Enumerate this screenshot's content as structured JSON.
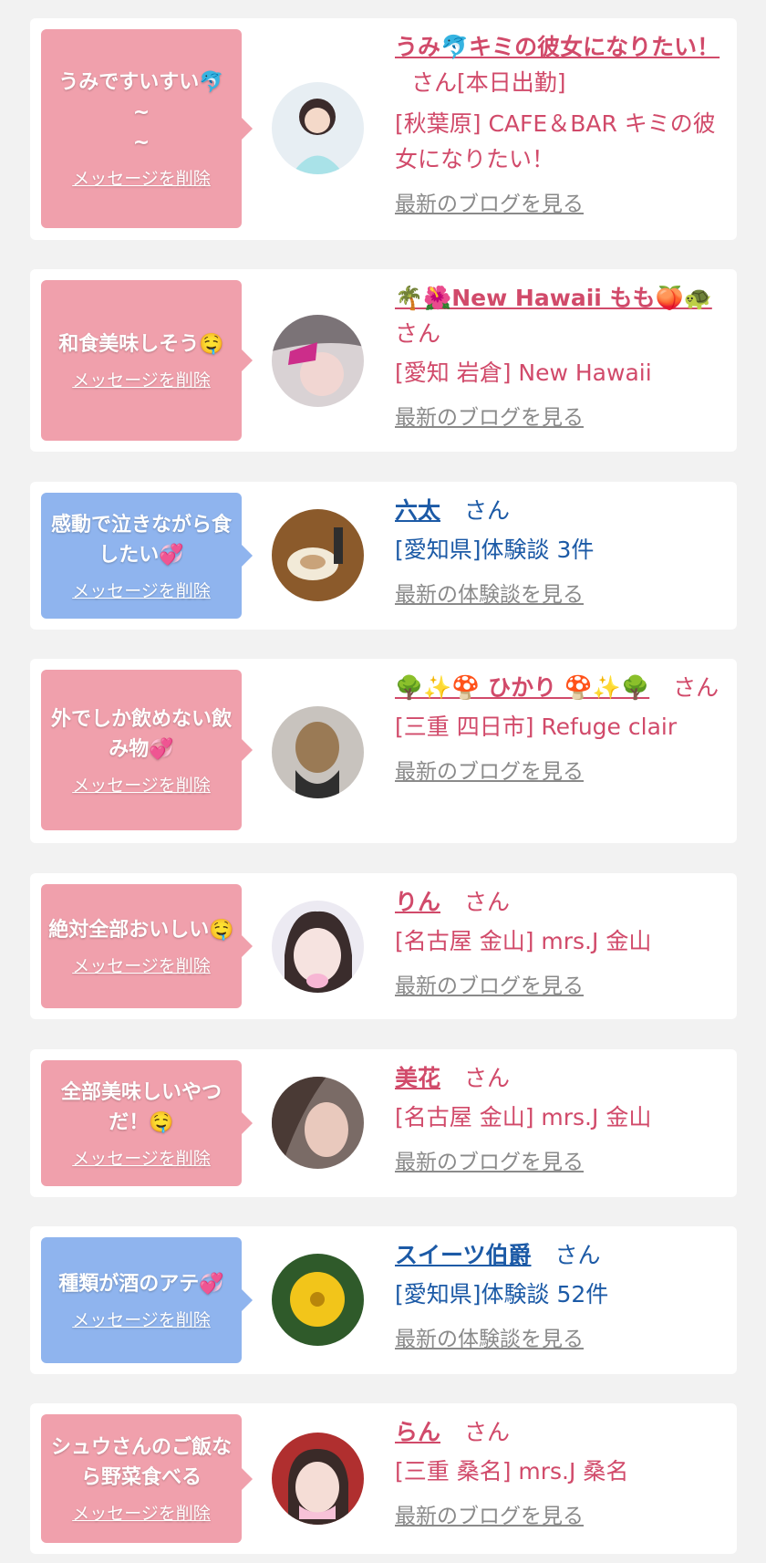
{
  "items": [
    {
      "bubble_color": "#f0a0ac",
      "message": "うみですいすい🐬\n~\n~",
      "delete_label": "メッセージを削除",
      "name": "うみ🐬キミの彼女になりたい！",
      "san": "さん[本日出勤]",
      "shop": "[秋葉原] CAFE＆BAR キミの彼女になりたい！",
      "more": "最新のブログを見る",
      "theme": "pink"
    },
    {
      "bubble_color": "#f0a0ac",
      "message": "和食美味しそう🤤",
      "delete_label": "メッセージを削除",
      "name": "🌴🌺New Hawaii もも🍑🐢",
      "san": "さん",
      "shop": "[愛知 岩倉] New Hawaii",
      "more": "最新のブログを見る",
      "theme": "pink"
    },
    {
      "bubble_color": "#8fb4ee",
      "message": "感動で泣きながら食したい💞",
      "delete_label": "メッセージを削除",
      "name": "六太",
      "san": "さん",
      "shop": "[愛知県]体験談 3件",
      "more": "最新の体験談を見る",
      "theme": "blue"
    },
    {
      "bubble_color": "#f0a0ac",
      "message": "外でしか飲めない飲み物💞",
      "delete_label": "メッセージを削除",
      "name": "🌳✨🍄 ひかり 🍄✨🌳",
      "san": "さん",
      "shop": "[三重 四日市] Refuge clair",
      "more": "最新のブログを見る",
      "theme": "pink"
    },
    {
      "bubble_color": "#f0a0ac",
      "message": "絶対全部おいしい🤤",
      "delete_label": "メッセージを削除",
      "name": "りん",
      "san": "さん",
      "shop": "[名古屋 金山] mrs.J 金山",
      "more": "最新のブログを見る",
      "theme": "pink"
    },
    {
      "bubble_color": "#f0a0ac",
      "message": "全部美味しいやつだ！🤤",
      "delete_label": "メッセージを削除",
      "name": "美花",
      "san": "さん",
      "shop": "[名古屋 金山] mrs.J 金山",
      "more": "最新のブログを見る",
      "theme": "pink"
    },
    {
      "bubble_color": "#8fb4ee",
      "message": "種類が酒のアテ💞",
      "delete_label": "メッセージを削除",
      "name": "スイーツ伯爵",
      "san": "さん",
      "shop": "[愛知県]体験談 52件",
      "more": "最新の体験談を見る",
      "theme": "blue"
    },
    {
      "bubble_color": "#f0a0ac",
      "message": "シュウさんのご飯なら野菜食べる",
      "delete_label": "メッセージを削除",
      "name": "らん",
      "san": "さん",
      "shop": "[三重 桑名] mrs.J 桑名",
      "more": "最新のブログを見る",
      "theme": "pink"
    }
  ],
  "colors": {
    "pink_text": "#d14a6a",
    "blue_text": "#1c5aa6",
    "link_gray": "#8a8a8a",
    "page_bg": "#f2f2f2"
  }
}
